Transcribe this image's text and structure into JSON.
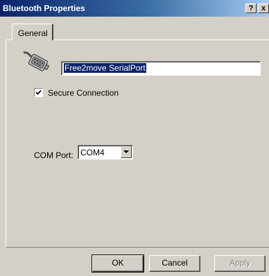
{
  "window": {
    "title": "Bluetooth Properties",
    "help_button": "?",
    "close_button": "x"
  },
  "tabs": [
    {
      "label": "General",
      "selected": true
    }
  ],
  "general": {
    "device_icon": "serial-port-icon",
    "device_name": "Free2move SerialPort",
    "device_name_selected": true,
    "secure_connection": {
      "label": "Secure Connection",
      "checked": true
    },
    "com_port": {
      "label": "COM Port:",
      "selected": "COM4"
    }
  },
  "buttons": {
    "ok": "OK",
    "cancel": "Cancel",
    "apply": "Apply",
    "apply_enabled": false
  },
  "colors": {
    "titlebar_start": "#0a246a",
    "titlebar_end": "#a6caf0",
    "face": "#d4d0c8",
    "selection": "#0a246a"
  }
}
